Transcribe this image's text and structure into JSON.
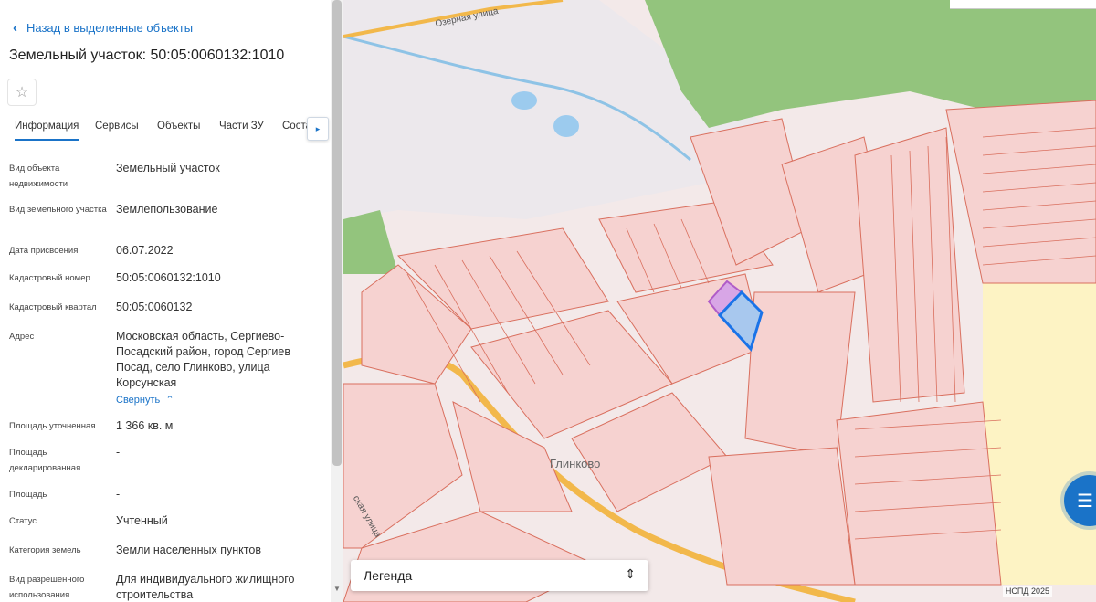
{
  "panel": {
    "back_label": "Назад в выделенные объекты",
    "title": "Земельный участок: 50:05:0060132:1010",
    "tabs": [
      "Информация",
      "Сервисы",
      "Объекты",
      "Части ЗУ",
      "Соста"
    ],
    "fields": [
      {
        "label": "Вид объекта недвижимости",
        "value": "Земельный участок"
      },
      {
        "label": "Вид земельного участка",
        "value": "Землепользование"
      },
      {
        "label": "Дата присвоения",
        "value": "06.07.2022"
      },
      {
        "label": "Кадастровый номер",
        "value": "50:05:0060132:1010"
      },
      {
        "label": "Кадастровый квартал",
        "value": "50:05:0060132"
      },
      {
        "label": "Адрес",
        "value": "Московская область, Сергиево-Посадский район, город Сергиев Посад, село Глинково, улица Корсунская"
      },
      {
        "label": "Площадь уточненная",
        "value": "1 366 кв. м"
      },
      {
        "label": "Площадь декларированная",
        "value": "-"
      },
      {
        "label": "Площадь",
        "value": "-"
      },
      {
        "label": "Статус",
        "value": "Учтенный"
      },
      {
        "label": "Категория земель",
        "value": "Земли населенных пунктов"
      },
      {
        "label": "Вид разрешенного использования",
        "value": "Для индивидуального жилищного строительства"
      }
    ],
    "collapse_label": "Свернуть"
  },
  "map": {
    "labels": {
      "street1": "Озерная улица",
      "village": "Глинково",
      "street2": "ская улица"
    },
    "legend_label": "Легенда",
    "credit": "НСПД 2025",
    "colors": {
      "parcel_fill": "#f6d2d0",
      "parcel_line": "#d96f5e",
      "forest": "#93c47d",
      "yellow_zone": "#fdf3c4",
      "road": "#f2b84b",
      "selected": "#1a73e8",
      "highlight": "#b05cc8"
    }
  },
  "icons": {
    "back": "chevron-left-icon",
    "star": "star-icon",
    "tab_next": "chevron-right-icon",
    "collapse": "chevron-up-icon",
    "legend": "unfold-icon",
    "chat": "chat-icon"
  }
}
